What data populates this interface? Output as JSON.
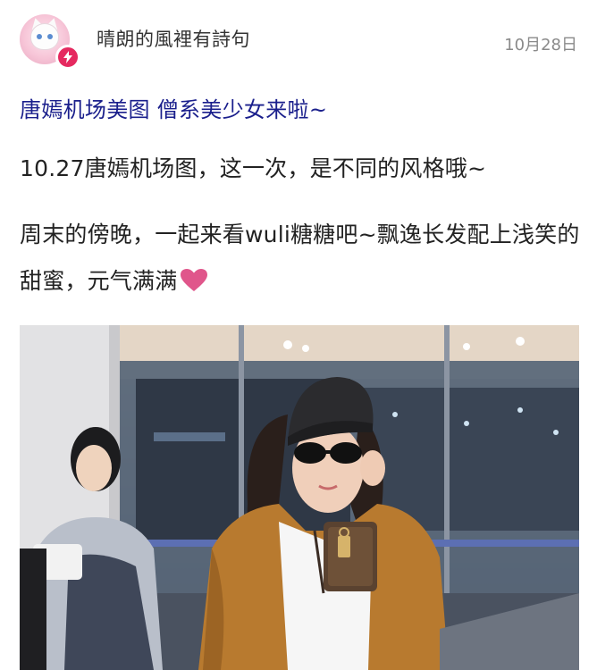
{
  "post": {
    "author": {
      "name": "晴朗的風裡有詩句",
      "avatar_icon": "cat-avatar",
      "badge_icon": "lightning-badge-icon"
    },
    "date": "10月28日",
    "title": "唐嫣机场美图 僧系美少女来啦~",
    "paragraphs": [
      "10.27唐嫣机场图，这一次，是不同的风格哦~",
      "周末的傍晚，一起来看wuli糖糖吧~飘逸长发配上浅笑的甜蜜，元气满满"
    ],
    "emoji": "heart-icon",
    "image": {
      "description_icon": "airport-photo"
    }
  },
  "colors": {
    "title": "#1a1f8c",
    "date": "#8a8a8a",
    "badge": "#e5295f",
    "heart": "#e0568b"
  }
}
